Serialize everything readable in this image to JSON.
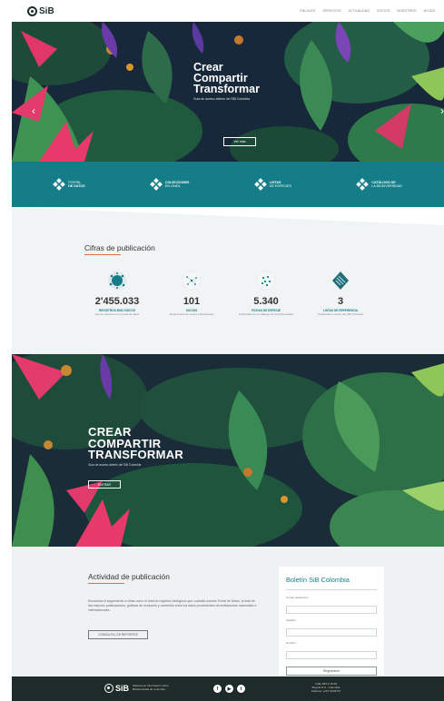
{
  "header": {
    "logo_text": "SiB",
    "nav": [
      "ENLACES",
      "SERVICIOS",
      "ACTUALIDAD",
      "SOCIOS",
      "NOSOTROS",
      "AYUDA"
    ]
  },
  "hero": {
    "title_lines": [
      "Crear",
      "Compartir",
      "Transformar"
    ],
    "subtitle": "Guía de acceso abierto del SiB Colombia",
    "button": "Ver más",
    "arrow_left": "‹",
    "arrow_right": "›",
    "slides": 7
  },
  "band": {
    "items": [
      {
        "icon": "dots-network-icon",
        "line1": "PORTAL",
        "line2": "DE DATOS"
      },
      {
        "icon": "dots-network-icon",
        "line1": "COLECCIONES",
        "line2": "EN LÍNEA"
      },
      {
        "icon": "dots-network-icon",
        "line1": "LISTAS",
        "line2": "DE ESPECIES"
      },
      {
        "icon": "dots-network-icon",
        "line1": "CATÁLOGO DE",
        "line2": "LA BIODIVERSIDAD"
      }
    ]
  },
  "stats": {
    "title": "Cifras de publicación",
    "items": [
      {
        "value": "2'455.033",
        "label": "REGISTROS BIOLÓGICOS",
        "desc": "Aporte nacional en el portal de datos"
      },
      {
        "value": "101",
        "label": "SOCIOS",
        "desc": "Exclusivamente socios publicadores"
      },
      {
        "value": "5.340",
        "label": "FICHAS DE ESPECIE",
        "desc": "Publicadas en el catálogo de la biodiversidad"
      },
      {
        "value": "3",
        "label": "LISTAS DE REFERENCIA",
        "desc": "Publicadas a través del SiB Colombia"
      }
    ]
  },
  "hero2": {
    "title_lines": [
      "CREAR",
      "COMPARTIR",
      "TRANSFORMAR"
    ],
    "subtitle": "Guía de acceso abierto del SiB Colombia",
    "button": "ENTRAR"
  },
  "activity": {
    "title": "Actividad de publicación",
    "text": "Encuentra el seguimiento a cifras como el total de registros biológicos que custodia nuestro Portal de Datos, la lista de las mayores publicaciones, gráficas de evolución y contenido entre los datos provenientes de instituciones nacionales e internacionales.",
    "button": "CONSULTA LOS REPORTES"
  },
  "newsletter": {
    "title": "Boletín SiB Colombia",
    "email_label": "Correo electrónico",
    "lastname_label": "Apellido",
    "name_label": "Nombre",
    "submit": "Registrarse"
  },
  "footer": {
    "logo_text": "SiB",
    "logo_sub": "Sistema de Información sobre Biodiversidad de Colombia",
    "social": [
      "f",
      "▶",
      "t"
    ],
    "address": [
      "Calle 28A # 15-09",
      "Bogotá D.C., Colombia",
      "Teléfono: (+57) 3202767"
    ]
  }
}
